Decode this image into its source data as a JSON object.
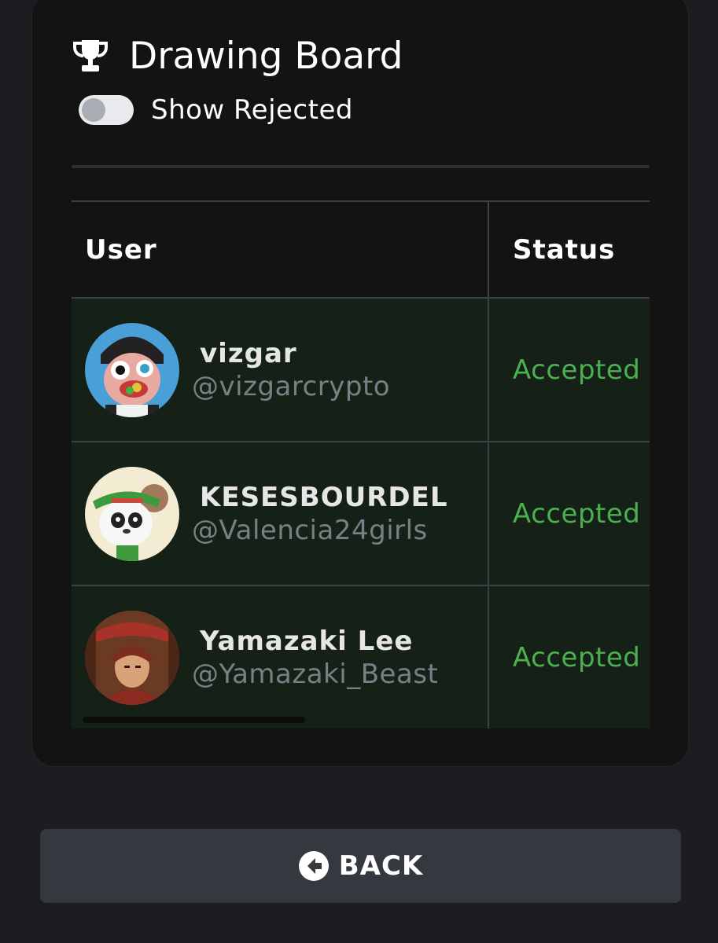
{
  "header": {
    "icon": "trophy-icon",
    "title": "Drawing Board"
  },
  "filter": {
    "show_rejected_label": "Show Rejected",
    "show_rejected_on": false
  },
  "table": {
    "columns": [
      "User",
      "Status"
    ],
    "rows": [
      {
        "name": "vizgar",
        "handle": "@vizgarcrypto",
        "status": "Accepted",
        "avatar": "avatar-vizgar"
      },
      {
        "name": "KESESBOURDEL",
        "handle": "@Valencia24girls",
        "status": "Accepted",
        "avatar": "avatar-kesesbourdel"
      },
      {
        "name": "Yamazaki Lee",
        "handle": "@Yamazaki_Beast",
        "status": "Accepted",
        "avatar": "avatar-yamazaki"
      }
    ]
  },
  "footer": {
    "back_label": "BACK",
    "back_icon": "arrow-left-circle-icon"
  },
  "colors": {
    "background": "#1c1d20",
    "card": "#131314",
    "row_accepted": "#152016",
    "status_accepted": "#4caf50",
    "button": "#35383e"
  }
}
